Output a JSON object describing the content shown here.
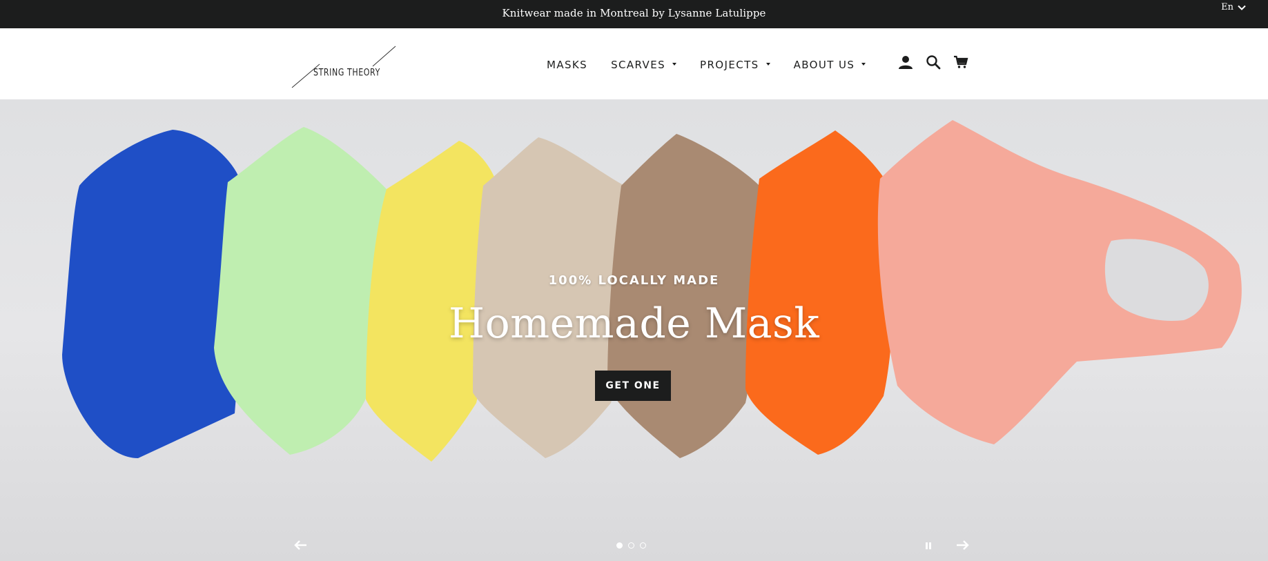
{
  "announcement": {
    "text": "Knitwear made in Montreal by Lysanne Latulippe"
  },
  "language": {
    "label": "En",
    "icon": "chevron-down-icon"
  },
  "logo": {
    "text": "STRING THEORY"
  },
  "nav": {
    "items": [
      {
        "label": "MASKS",
        "has_dropdown": false
      },
      {
        "label": "SCARVES",
        "has_dropdown": true
      },
      {
        "label": "PROJECTS",
        "has_dropdown": true
      },
      {
        "label": "ABOUT US",
        "has_dropdown": true
      }
    ],
    "icons": [
      "account-icon",
      "search-icon",
      "cart-icon"
    ]
  },
  "hero": {
    "subheading": "100% LOCALLY MADE",
    "heading": "Homemade Mask",
    "button_label": "GET ONE",
    "slides_count": 3,
    "active_slide": 1,
    "controls": [
      "prev-arrow-icon",
      "pause-icon",
      "next-arrow-icon"
    ],
    "mask_colors": [
      "#1f4fc6",
      "#bfeeb0",
      "#f3e460",
      "#d6c6b3",
      "#a98a72",
      "#fb6a1c",
      "#f5a99a"
    ]
  },
  "colors": {
    "bar": "#1c1d1d",
    "text_dark": "#1c1d1d",
    "white": "#ffffff"
  }
}
